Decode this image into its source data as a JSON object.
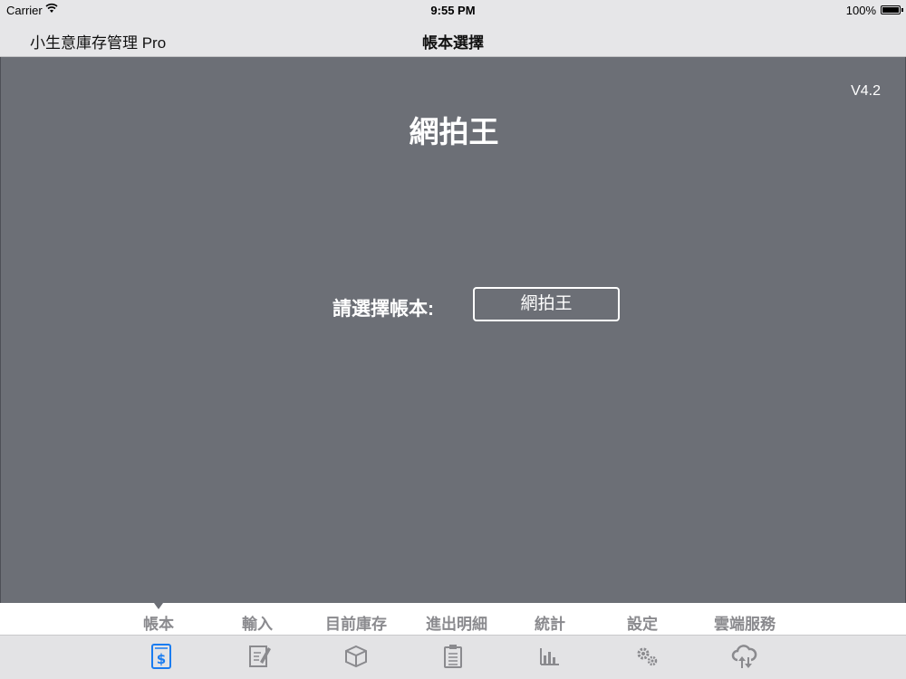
{
  "status_bar": {
    "carrier": "Carrier",
    "time": "9:55 PM",
    "battery": "100%"
  },
  "nav": {
    "app_title": "小生意庫存管理 Pro",
    "title": "帳本選擇"
  },
  "main": {
    "version": "V4.2",
    "book_title": "網拍王",
    "select_label": "請選擇帳本:",
    "selected_book": "網拍王"
  },
  "tabs": [
    {
      "label": "帳本",
      "icon": "ledger-dollar-icon",
      "active": true
    },
    {
      "label": "輸入",
      "icon": "edit-note-icon",
      "active": false
    },
    {
      "label": "目前庫存",
      "icon": "box-icon",
      "active": false
    },
    {
      "label": "進出明細",
      "icon": "clipboard-icon",
      "active": false
    },
    {
      "label": "統計",
      "icon": "bar-chart-icon",
      "active": false
    },
    {
      "label": "設定",
      "icon": "gears-icon",
      "active": false
    },
    {
      "label": "雲端服務",
      "icon": "cloud-sync-icon",
      "active": false
    }
  ],
  "colors": {
    "accent": "#1a7cf0",
    "inactive": "#8a8a8e",
    "background": "#6c6f76"
  }
}
